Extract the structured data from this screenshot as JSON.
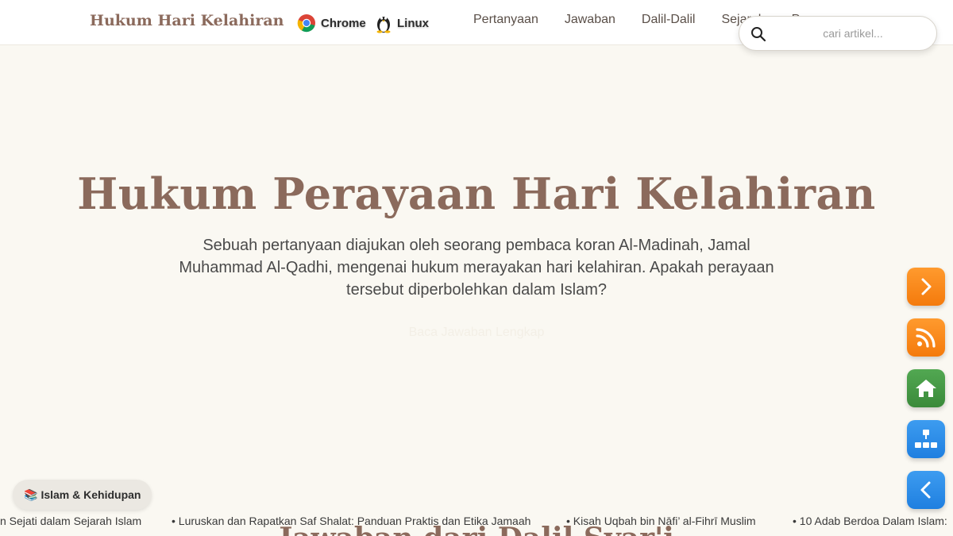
{
  "header": {
    "brand": "Hukum Hari Kelahiran",
    "badges": [
      {
        "label": "Chrome",
        "icon": "chrome-icon"
      },
      {
        "label": "Linux",
        "icon": "linux-tux-icon"
      }
    ],
    "nav": [
      "Pertanyaan",
      "Jawaban",
      "Dalil-Dalil",
      "Sejarah",
      "Pe..."
    ]
  },
  "search": {
    "placeholder": "cari artikel...",
    "value": ""
  },
  "hero": {
    "title": "Hukum Perayaan Hari Kelahiran",
    "subtitle": "Sebuah pertanyaan diajukan oleh seorang pembaca koran Al-Madinah, Jamal Muhammad Al-Qadhi, mengenai hukum merayakan hari kelahiran. Apakah perayaan tersebut diperbolehkan dalam Islam?",
    "cta": "Baca Jawaban Lengkap"
  },
  "side_buttons": [
    {
      "name": "next",
      "icon": "chevron-right-icon",
      "color": "#f47a0c"
    },
    {
      "name": "rss",
      "icon": "rss-icon",
      "color": "#f47a0c"
    },
    {
      "name": "home",
      "icon": "home-icon",
      "color": "#3a8a3a"
    },
    {
      "name": "sitemap",
      "icon": "sitemap-icon",
      "color": "#1f7fe0"
    },
    {
      "name": "back",
      "icon": "chevron-left-icon",
      "color": "#1f7fe0"
    }
  ],
  "category_pill": {
    "emoji": "📚",
    "label": "Islam & Kehidupan"
  },
  "ticker": [
    "n Sejati dalam Sejarah Islam",
    "• Luruskan dan Rapatkan Saf Shalat: Panduan Praktis dan Etika Jamaah",
    "• Kisah Uqbah bin Nāfi’ al-Fihrī Muslim",
    "• 10 Adab Berdoa Dalam Islam:"
  ],
  "section_heading": "Jawaban dari Dalil Syar'i",
  "colors": {
    "brand": "#8b6a5c",
    "background": "#faf8f2",
    "orange": "#f47a0c",
    "green": "#3a8a3a",
    "blue": "#1f7fe0"
  }
}
